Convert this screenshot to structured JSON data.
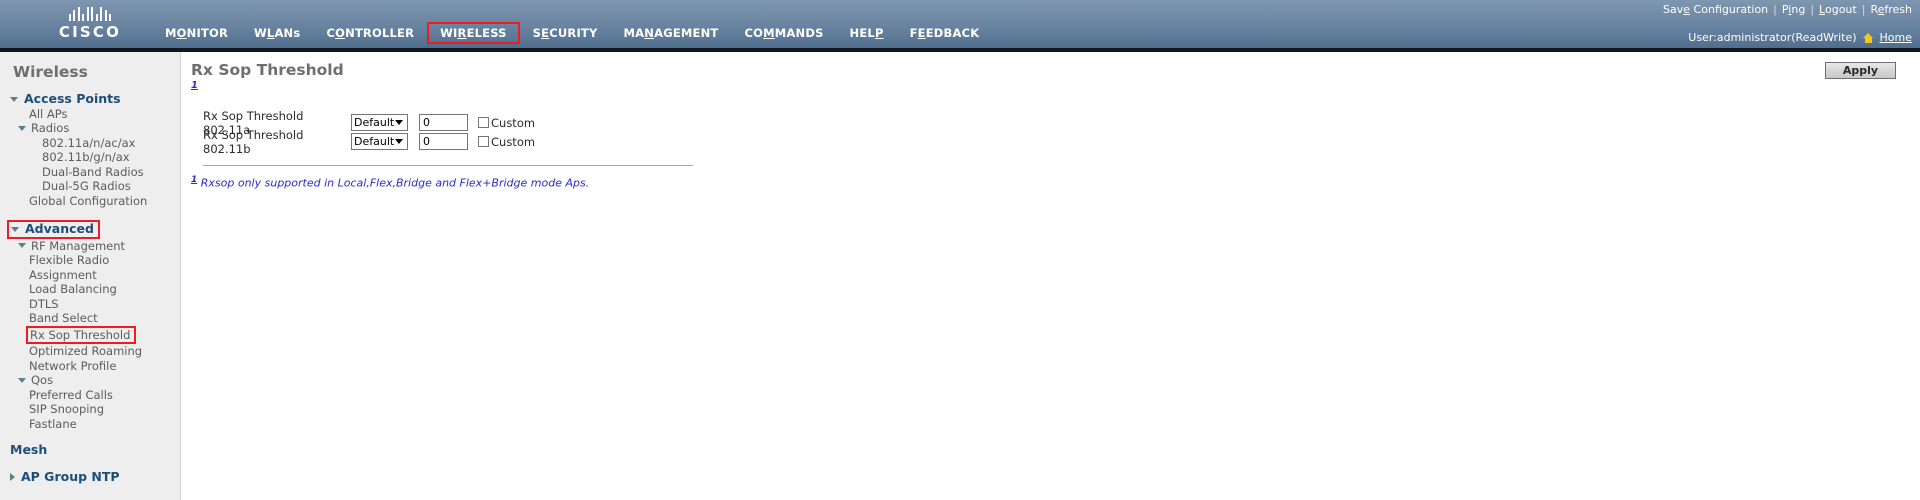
{
  "banner": {
    "logo_word": "CISCO",
    "logo_icon": "cisco-bridge-logo",
    "nav": [
      {
        "label": "MONITOR",
        "accel_index": 1,
        "selected": false
      },
      {
        "label": "WLANs",
        "accel_index": 1,
        "selected": false
      },
      {
        "label": "CONTROLLER",
        "accel_index": 1,
        "selected": false
      },
      {
        "label": "WIRELESS",
        "accel_index": 2,
        "selected": true
      },
      {
        "label": "SECURITY",
        "accel_index": 1,
        "selected": false
      },
      {
        "label": "MANAGEMENT",
        "accel_index": 2,
        "selected": false
      },
      {
        "label": "COMMANDS",
        "accel_index": 2,
        "selected": false
      },
      {
        "label": "HELP",
        "accel_index": 3,
        "selected": false
      },
      {
        "label": "FEEDBACK",
        "accel_index": 1,
        "selected": false
      }
    ],
    "links": [
      {
        "label": "Save Configuration",
        "accel_index": 3
      },
      {
        "label": "Ping",
        "accel_index": 1
      },
      {
        "label": "Logout",
        "accel_index": 0
      },
      {
        "label": "Refresh",
        "accel_index": 1
      }
    ],
    "separator": "|",
    "user_text": "User:administrator(ReadWrite)",
    "home_label": "Home",
    "home_icon": "home-icon",
    "accent_red": "#ee1c25",
    "banner_blue": "#5e7b99"
  },
  "sidebar": {
    "title": "Wireless",
    "items": [
      {
        "label": "Access Points",
        "level": 0,
        "icon": "caret-down-icon",
        "highlight": false
      },
      {
        "label": "All APs",
        "level": 1,
        "icon": "",
        "highlight": false
      },
      {
        "label": "Radios",
        "level": 1,
        "icon": "caret-down-icon",
        "highlight": false
      },
      {
        "label": "802.11a/n/ac/ax",
        "level": 2,
        "icon": "",
        "highlight": false
      },
      {
        "label": "802.11b/g/n/ax",
        "level": 2,
        "icon": "",
        "highlight": false
      },
      {
        "label": "Dual-Band Radios",
        "level": 2,
        "icon": "",
        "highlight": false
      },
      {
        "label": "Dual-5G Radios",
        "level": 2,
        "icon": "",
        "highlight": false
      },
      {
        "label": "Global Configuration",
        "level": 1,
        "icon": "",
        "highlight": false
      },
      {
        "label": "Advanced",
        "level": 0,
        "icon": "caret-down-icon",
        "highlight": true
      },
      {
        "label": "RF Management",
        "level": 1,
        "icon": "caret-down-icon",
        "highlight": false
      },
      {
        "label": "Flexible Radio",
        "level": 1,
        "icon": "",
        "highlight": false
      },
      {
        "label": "Assignment",
        "level": 1,
        "icon": "",
        "highlight": false
      },
      {
        "label": "Load Balancing",
        "level": 1,
        "icon": "",
        "highlight": false
      },
      {
        "label": "DTLS",
        "level": 1,
        "icon": "",
        "highlight": false
      },
      {
        "label": "Band Select",
        "level": 1,
        "icon": "",
        "highlight": false
      },
      {
        "label": "Rx Sop Threshold",
        "level": 1,
        "icon": "",
        "highlight": true
      },
      {
        "label": "Optimized Roaming",
        "level": 1,
        "icon": "",
        "highlight": false
      },
      {
        "label": "Network Profile",
        "level": 1,
        "icon": "",
        "highlight": false
      },
      {
        "label": "Qos",
        "level": 1,
        "icon": "caret-down-icon",
        "highlight": false
      },
      {
        "label": "Preferred Calls",
        "level": 1,
        "icon": "",
        "highlight": false
      },
      {
        "label": "SIP Snooping",
        "level": 1,
        "icon": "",
        "highlight": false
      },
      {
        "label": "Fastlane",
        "level": 1,
        "icon": "",
        "highlight": false
      },
      {
        "label": "Mesh",
        "level": 0,
        "icon": "",
        "highlight": false
      },
      {
        "label": "AP Group NTP",
        "level": 0,
        "icon": "caret-right-icon",
        "highlight": false
      }
    ]
  },
  "main": {
    "title": "Rx Sop Threshold",
    "title_note_marker": "1",
    "apply_label": "Apply",
    "rows": [
      {
        "label": "Rx Sop Threshold 802.11a",
        "select_value": "Default",
        "input_value": "0",
        "checkbox_label": "Custom",
        "checkbox_checked": false
      },
      {
        "label": "Rx Sop Threshold 802.11b",
        "select_value": "Default",
        "input_value": "0",
        "checkbox_label": "Custom",
        "checkbox_checked": false
      }
    ],
    "footnote_marker": "1",
    "footnote": "Rxsop only supported in Local,Flex,Bridge and Flex+Bridge mode Aps."
  }
}
